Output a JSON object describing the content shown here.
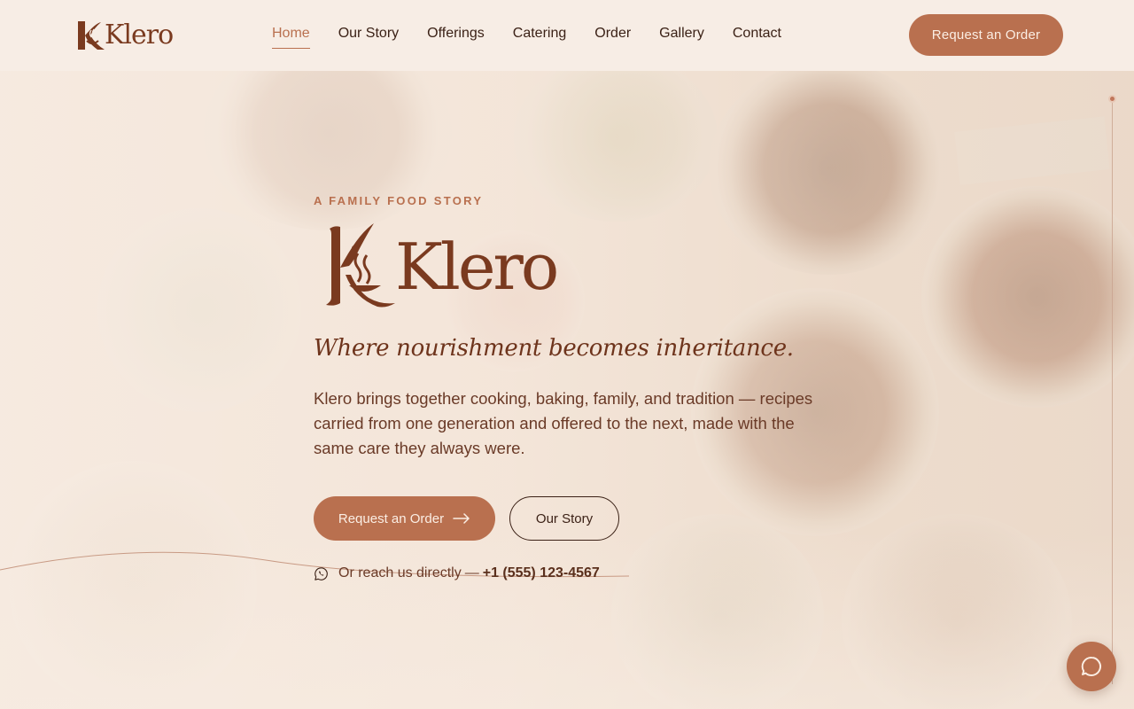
{
  "brand": {
    "name": "Klero",
    "icon": "klero-steam-bowl-logo"
  },
  "nav": {
    "items": [
      {
        "label": "Home",
        "active": true
      },
      {
        "label": "Our Story",
        "active": false
      },
      {
        "label": "Offerings",
        "active": false
      },
      {
        "label": "Catering",
        "active": false
      },
      {
        "label": "Order",
        "active": false
      },
      {
        "label": "Gallery",
        "active": false
      },
      {
        "label": "Contact",
        "active": false
      }
    ],
    "cta_label": "Request an Order"
  },
  "hero": {
    "eyebrow": "A FAMILY FOOD STORY",
    "logo_text": "Klero",
    "tagline": "Where nourishment becomes inheritance.",
    "lede": "Klero brings together cooking, baking, family, and tradition — recipes carried from one generation and offered to the next, made with the same care they always were.",
    "primary_cta": {
      "label": "Request an Order",
      "icon": "arrow-right-icon"
    },
    "secondary_cta": {
      "label": "Our Story"
    },
    "reach": {
      "icon": "whatsapp-icon",
      "prefix": "Or reach us directly",
      "separator": "—",
      "phone": "+1 (555) 123-4567"
    }
  },
  "chat": {
    "icon": "chat-bubble-icon"
  },
  "colors": {
    "accent": "#b9704f",
    "brand_brown": "#7a3a1f",
    "text_dark": "#3b2116",
    "header_bg": "#f7ede5"
  }
}
